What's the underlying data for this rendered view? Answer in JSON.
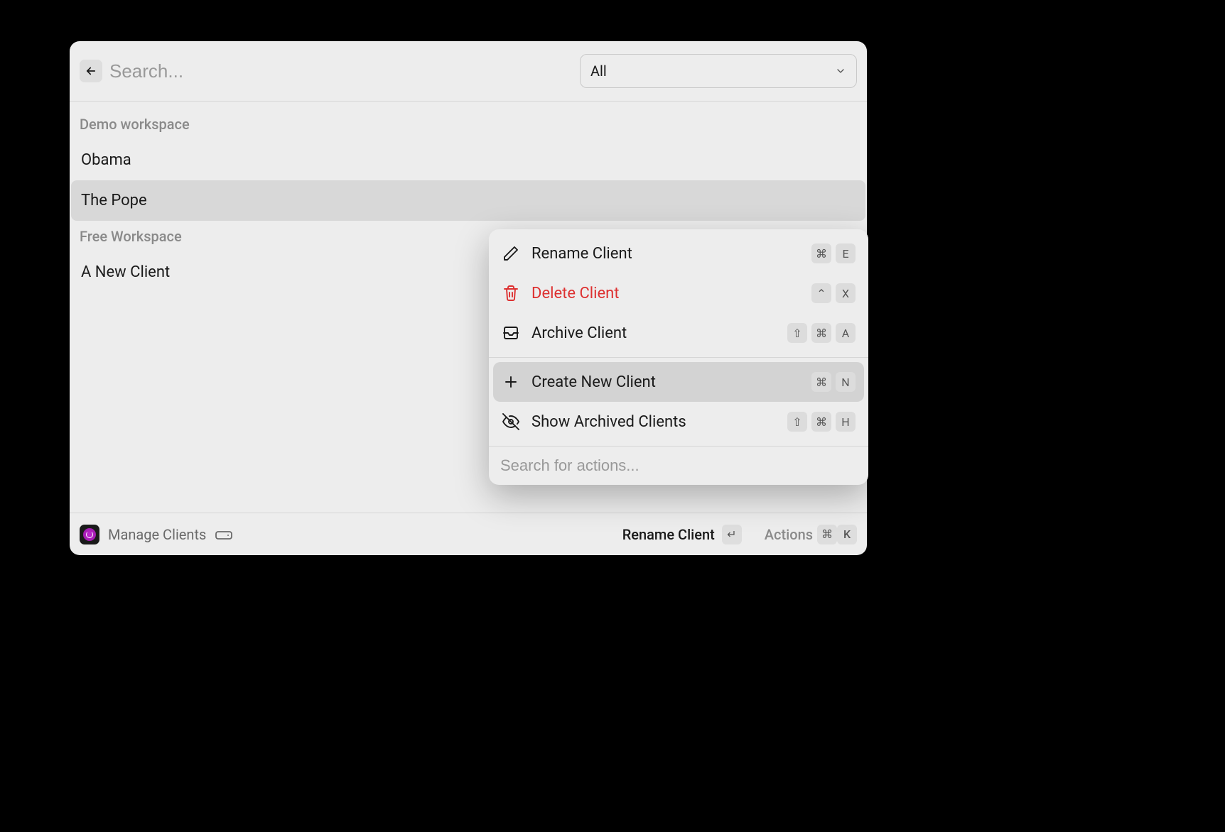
{
  "header": {
    "search_placeholder": "Search...",
    "filter_selected": "All"
  },
  "sections": [
    {
      "label": "Demo workspace",
      "items": [
        {
          "name": "Obama",
          "selected": false
        },
        {
          "name": "The Pope",
          "selected": true
        }
      ]
    },
    {
      "label": "Free Workspace",
      "items": [
        {
          "name": "A New Client",
          "selected": false
        }
      ]
    }
  ],
  "context_menu": {
    "groups": [
      [
        {
          "icon": "pencil-icon",
          "label": "Rename Client",
          "keys": [
            "⌘",
            "E"
          ],
          "danger": false,
          "highlight": false
        },
        {
          "icon": "trash-icon",
          "label": "Delete Client",
          "keys": [
            "⌃",
            "X"
          ],
          "danger": true,
          "highlight": false
        },
        {
          "icon": "inbox-icon",
          "label": "Archive Client",
          "keys": [
            "⇧",
            "⌘",
            "A"
          ],
          "danger": false,
          "highlight": false
        }
      ],
      [
        {
          "icon": "plus-icon",
          "label": "Create New Client",
          "keys": [
            "⌘",
            "N"
          ],
          "danger": false,
          "highlight": true
        },
        {
          "icon": "eye-off-icon",
          "label": "Show Archived Clients",
          "keys": [
            "⇧",
            "⌘",
            "H"
          ],
          "danger": false,
          "highlight": false
        }
      ]
    ],
    "search_placeholder": "Search for actions..."
  },
  "footer": {
    "manage_label": "Manage Clients",
    "hint_label": "Rename Client",
    "hint_key": "↵",
    "actions_label": "Actions",
    "actions_keys": [
      "⌘",
      "K"
    ]
  }
}
